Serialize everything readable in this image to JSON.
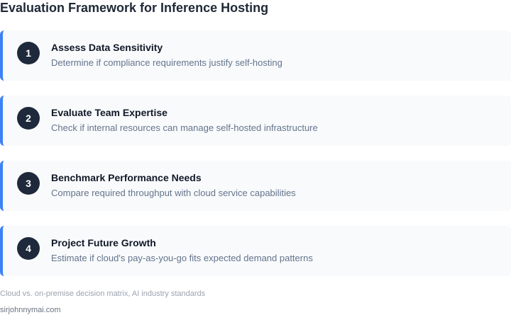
{
  "title": "Evaluation Framework for Inference Hosting",
  "accent_color": "#3b82f6",
  "steps": [
    {
      "number": "1",
      "title": "Assess Data Sensitivity",
      "description": "Determine if compliance requirements justify self-hosting"
    },
    {
      "number": "2",
      "title": "Evaluate Team Expertise",
      "description": "Check if internal resources can manage self-hosted infrastructure"
    },
    {
      "number": "3",
      "title": "Benchmark Performance Needs",
      "description": "Compare required throughput with cloud service capabilities"
    },
    {
      "number": "4",
      "title": "Project Future Growth",
      "description": "Estimate if cloud's pay-as-you-go fits expected demand patterns"
    }
  ],
  "source": "Cloud vs. on-premise decision matrix, AI industry standards",
  "credit": "sirjohnnymai.com"
}
